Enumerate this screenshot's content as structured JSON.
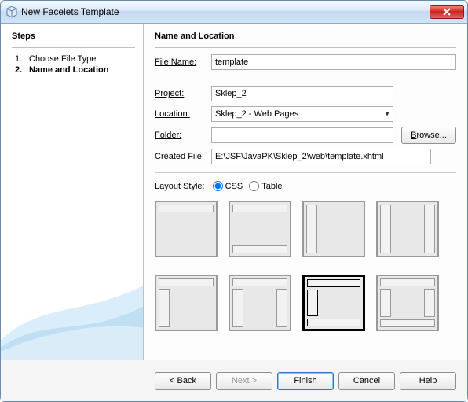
{
  "window": {
    "title": "New Facelets Template"
  },
  "steps": {
    "heading": "Steps",
    "items": [
      {
        "num": "1.",
        "label": "Choose File Type",
        "current": false
      },
      {
        "num": "2.",
        "label": "Name and Location",
        "current": true
      }
    ]
  },
  "content": {
    "heading": "Name and Location",
    "filename_label": "File Name:",
    "filename_value": "template",
    "project_label": "Project:",
    "project_value": "Sklep_2",
    "location_label": "Location:",
    "location_value": "Sklep_2 - Web Pages",
    "folder_label": "Folder:",
    "folder_value": "",
    "browse_label": "Browse...",
    "created_label": "Created File:",
    "created_value": "E:\\JSF\\JavaPK\\Sklep_2\\web\\template.xhtml",
    "layout_label": "Layout Style:",
    "radio_css": "CSS",
    "radio_table": "Table",
    "layout_selected_index": 6
  },
  "buttons": {
    "back": "< Back",
    "next": "Next >",
    "finish": "Finish",
    "cancel": "Cancel",
    "help": "Help"
  }
}
